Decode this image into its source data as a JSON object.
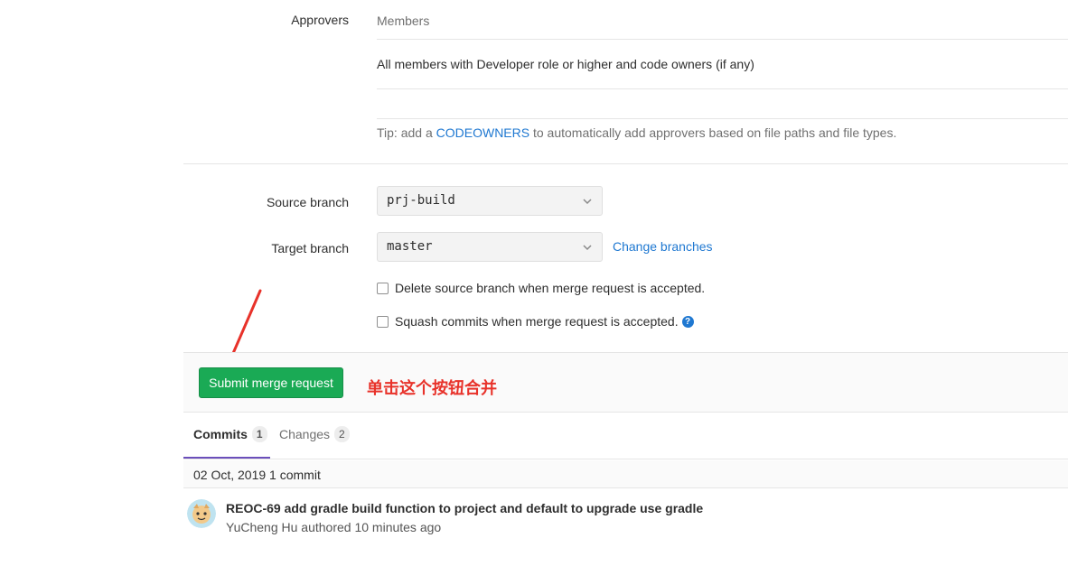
{
  "approvers": {
    "label": "Approvers",
    "column_header": "Members",
    "rule_text": "All members with Developer role or higher and code owners (if any)",
    "tip_prefix": "Tip: add a ",
    "tip_link": "CODEOWNERS",
    "tip_suffix": " to automatically add approvers based on file paths and file types."
  },
  "branches": {
    "source_label": "Source branch",
    "source_value": "prj-build",
    "target_label": "Target branch",
    "target_value": "master",
    "change_link": "Change branches"
  },
  "options": {
    "delete_source": "Delete source branch when merge request is accepted.",
    "squash": "Squash commits when merge request is accepted.",
    "help_glyph": "?"
  },
  "actions": {
    "submit_label": "Submit merge request",
    "annotation_text": "单击这个按钮合并"
  },
  "tabs": [
    {
      "label": "Commits",
      "count": "1",
      "active": true
    },
    {
      "label": "Changes",
      "count": "2",
      "active": false
    }
  ],
  "commits": {
    "day_header": "02 Oct, 2019 1 commit",
    "items": [
      {
        "title": "REOC-69 add gradle build function to project and default to upgrade use gradle",
        "author": "YuCheng Hu",
        "meta": " authored 10 minutes ago"
      }
    ]
  },
  "colors": {
    "accent_link": "#1f78d1",
    "submit_green": "#1aaa55",
    "annotation_red": "#e8322a",
    "active_tab": "#6b4fbb"
  },
  "icons": [
    "chevron-down-icon",
    "help-icon",
    "arrow-annotation-icon",
    "avatar"
  ]
}
